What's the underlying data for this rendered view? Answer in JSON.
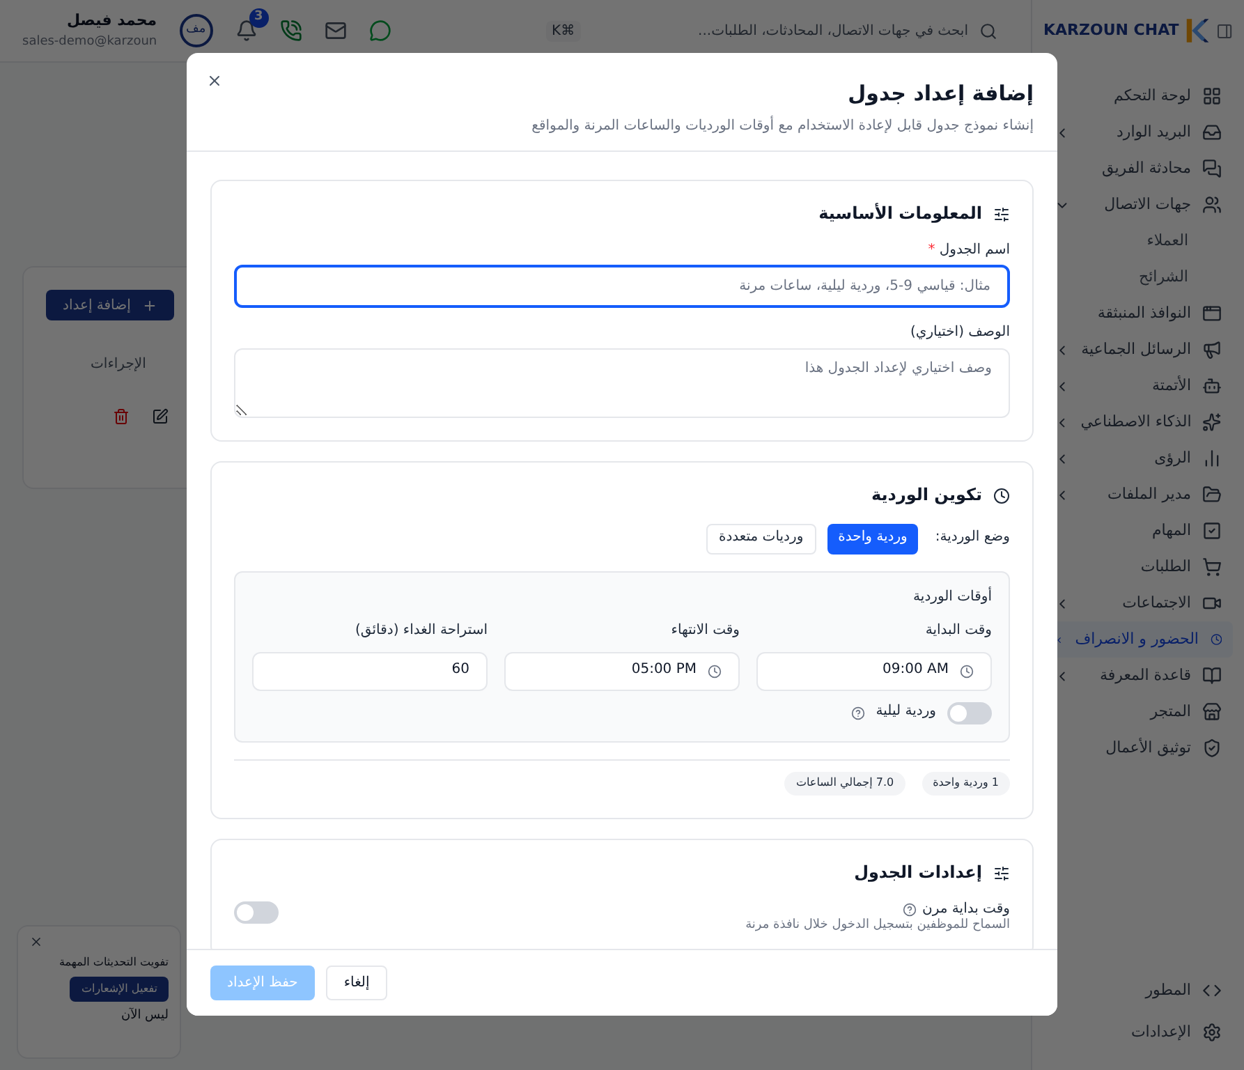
{
  "sidebar": {
    "brand": "KARZOUN CHAT",
    "items": [
      {
        "label": "لوحة التحكم",
        "selected": false
      },
      {
        "label": "البريد الوارد",
        "selected": false,
        "expanded": false
      },
      {
        "label": "محادثة الفريق",
        "selected": false
      },
      {
        "label": "جهات الاتصال",
        "selected": false,
        "expanded": true,
        "children": [
          {
            "label": "العملاء",
            "selected": false
          },
          {
            "label": "الشرائح",
            "selected": false
          }
        ]
      },
      {
        "label": "النوافذ المنبثقة",
        "selected": false
      },
      {
        "label": "الرسائل الجماعية",
        "selected": false,
        "expanded": false
      },
      {
        "label": "الأتمتة",
        "selected": false,
        "expanded": false
      },
      {
        "label": "الذكاء الاصطناعي",
        "selected": false,
        "expanded": false
      },
      {
        "label": "الرؤى",
        "selected": false,
        "expanded": false
      },
      {
        "label": "مدير الملفات",
        "selected": false,
        "expanded": false
      },
      {
        "label": "المهام",
        "selected": false
      },
      {
        "label": "الطلبات",
        "selected": false
      },
      {
        "label": "الاجتماعات",
        "selected": false,
        "expanded": false
      },
      {
        "label": "الحضور و الانصراف",
        "selected": true,
        "expanded": false
      },
      {
        "label": "قاعدة المعرفة",
        "selected": false,
        "expanded": false
      },
      {
        "label": "المتجر",
        "selected": false
      },
      {
        "label": "توثيق الأعمال",
        "selected": false
      }
    ],
    "bottom_items": [
      {
        "label": "المطور"
      },
      {
        "label": "الإعدادات"
      }
    ]
  },
  "topbar": {
    "search_placeholder": "ابحث في جهات الاتصال، المحادثات، الطلبات...",
    "shortcut": "⌘K",
    "notification_count": "3",
    "user": {
      "initials": "مف",
      "name": "محمد فيصل",
      "email": "sales-demo@karzoun"
    }
  },
  "page": {
    "add_button": "إضافة إعداد",
    "actions_column": "الإجراءات"
  },
  "toast": {
    "message": "تفويت التحديثات المهمة",
    "enable_button": "تفعيل الإشعارات",
    "dismiss_button": "ليس الآن"
  },
  "modal": {
    "title": "إضافة إعداد جدول",
    "subtitle": "إنشاء نموذج جدول قابل لإعادة الاستخدام مع أوقات الورديات والساعات المرنة والمواقع",
    "basic_info": {
      "title": "المعلومات الأساسية",
      "name_field": {
        "label": "اسم الجدول",
        "required_mark": "*",
        "placeholder": "مثال: قياسي 9-5، وردية ليلية، ساعات مرنة",
        "focused": true
      },
      "description_field": {
        "label": "الوصف (اختياري)",
        "placeholder": "وصف اختياري لإعداد الجدول هذا"
      }
    },
    "shift_config": {
      "title": "تكوين الوردية",
      "mode_label": "وضع الوردية:",
      "modes": [
        {
          "label": "وردية واحدة",
          "selected": true
        },
        {
          "label": "ورديات متعددة",
          "selected": false
        }
      ],
      "times_title": "أوقات الوردية",
      "fields": [
        {
          "kind": "time",
          "label": "وقت البداية",
          "value": "09:00 AM"
        },
        {
          "kind": "time",
          "label": "وقت الانتهاء",
          "value": "05:00 PM"
        },
        {
          "kind": "number",
          "label": "استراحة الغداء (دقائق)",
          "value": "60"
        }
      ],
      "night_shift": {
        "label": "وردية ليلية",
        "on": false
      },
      "summary": [
        "1 وردية واحدة",
        "7.0 إجمالي الساعات"
      ]
    },
    "settings": {
      "title": "إعدادات الجدول",
      "flexible_start": {
        "label": "وقت بداية مرن",
        "description": "السماح للموظفين بتسجيل الدخول خلال نافذة مرنة",
        "on": false
      }
    },
    "buttons": [
      {
        "kind": "secondary",
        "label": "إلغاء",
        "disabled": false
      },
      {
        "kind": "primary",
        "label": "حفظ الإعداد",
        "disabled": true
      }
    ]
  }
}
